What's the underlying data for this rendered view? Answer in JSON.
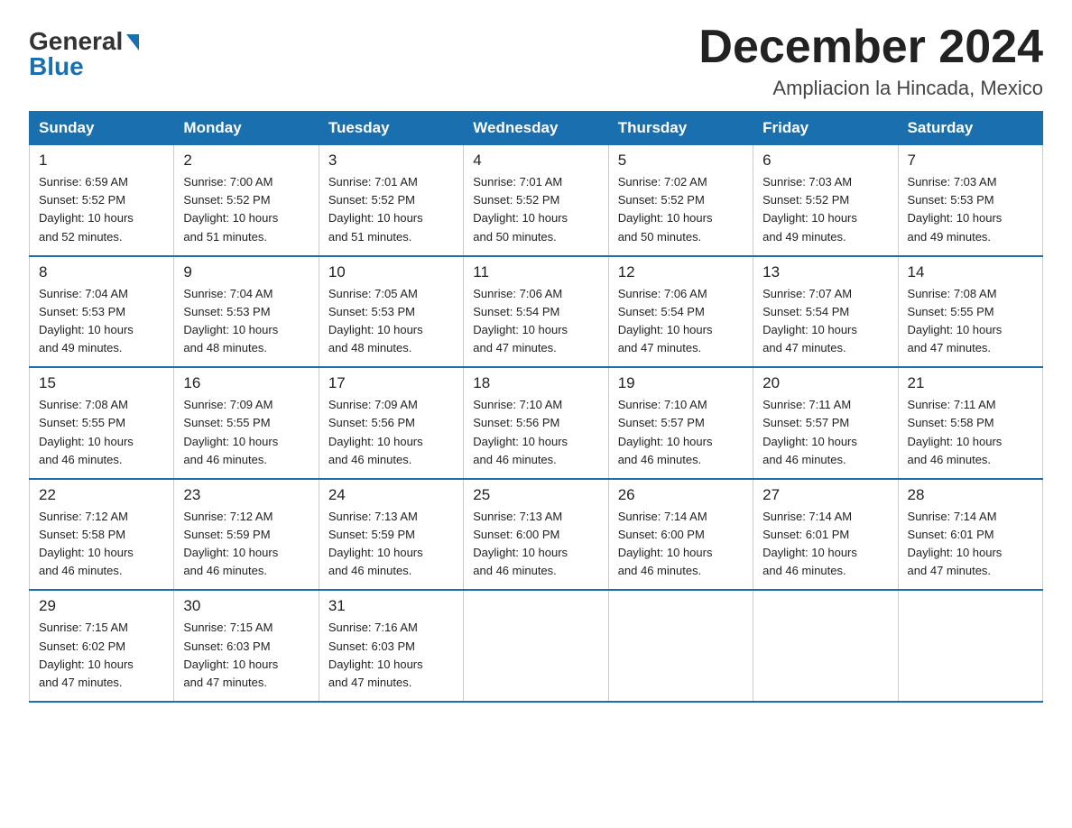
{
  "logo": {
    "text_general": "General",
    "text_blue": "Blue",
    "arrow": true
  },
  "header": {
    "month_title": "December 2024",
    "location": "Ampliacion la Hincada, Mexico"
  },
  "weekdays": [
    "Sunday",
    "Monday",
    "Tuesday",
    "Wednesday",
    "Thursday",
    "Friday",
    "Saturday"
  ],
  "weeks": [
    [
      {
        "day": "1",
        "sunrise": "6:59 AM",
        "sunset": "5:52 PM",
        "daylight": "10 hours and 52 minutes."
      },
      {
        "day": "2",
        "sunrise": "7:00 AM",
        "sunset": "5:52 PM",
        "daylight": "10 hours and 51 minutes."
      },
      {
        "day": "3",
        "sunrise": "7:01 AM",
        "sunset": "5:52 PM",
        "daylight": "10 hours and 51 minutes."
      },
      {
        "day": "4",
        "sunrise": "7:01 AM",
        "sunset": "5:52 PM",
        "daylight": "10 hours and 50 minutes."
      },
      {
        "day": "5",
        "sunrise": "7:02 AM",
        "sunset": "5:52 PM",
        "daylight": "10 hours and 50 minutes."
      },
      {
        "day": "6",
        "sunrise": "7:03 AM",
        "sunset": "5:52 PM",
        "daylight": "10 hours and 49 minutes."
      },
      {
        "day": "7",
        "sunrise": "7:03 AM",
        "sunset": "5:53 PM",
        "daylight": "10 hours and 49 minutes."
      }
    ],
    [
      {
        "day": "8",
        "sunrise": "7:04 AM",
        "sunset": "5:53 PM",
        "daylight": "10 hours and 49 minutes."
      },
      {
        "day": "9",
        "sunrise": "7:04 AM",
        "sunset": "5:53 PM",
        "daylight": "10 hours and 48 minutes."
      },
      {
        "day": "10",
        "sunrise": "7:05 AM",
        "sunset": "5:53 PM",
        "daylight": "10 hours and 48 minutes."
      },
      {
        "day": "11",
        "sunrise": "7:06 AM",
        "sunset": "5:54 PM",
        "daylight": "10 hours and 47 minutes."
      },
      {
        "day": "12",
        "sunrise": "7:06 AM",
        "sunset": "5:54 PM",
        "daylight": "10 hours and 47 minutes."
      },
      {
        "day": "13",
        "sunrise": "7:07 AM",
        "sunset": "5:54 PM",
        "daylight": "10 hours and 47 minutes."
      },
      {
        "day": "14",
        "sunrise": "7:08 AM",
        "sunset": "5:55 PM",
        "daylight": "10 hours and 47 minutes."
      }
    ],
    [
      {
        "day": "15",
        "sunrise": "7:08 AM",
        "sunset": "5:55 PM",
        "daylight": "10 hours and 46 minutes."
      },
      {
        "day": "16",
        "sunrise": "7:09 AM",
        "sunset": "5:55 PM",
        "daylight": "10 hours and 46 minutes."
      },
      {
        "day": "17",
        "sunrise": "7:09 AM",
        "sunset": "5:56 PM",
        "daylight": "10 hours and 46 minutes."
      },
      {
        "day": "18",
        "sunrise": "7:10 AM",
        "sunset": "5:56 PM",
        "daylight": "10 hours and 46 minutes."
      },
      {
        "day": "19",
        "sunrise": "7:10 AM",
        "sunset": "5:57 PM",
        "daylight": "10 hours and 46 minutes."
      },
      {
        "day": "20",
        "sunrise": "7:11 AM",
        "sunset": "5:57 PM",
        "daylight": "10 hours and 46 minutes."
      },
      {
        "day": "21",
        "sunrise": "7:11 AM",
        "sunset": "5:58 PM",
        "daylight": "10 hours and 46 minutes."
      }
    ],
    [
      {
        "day": "22",
        "sunrise": "7:12 AM",
        "sunset": "5:58 PM",
        "daylight": "10 hours and 46 minutes."
      },
      {
        "day": "23",
        "sunrise": "7:12 AM",
        "sunset": "5:59 PM",
        "daylight": "10 hours and 46 minutes."
      },
      {
        "day": "24",
        "sunrise": "7:13 AM",
        "sunset": "5:59 PM",
        "daylight": "10 hours and 46 minutes."
      },
      {
        "day": "25",
        "sunrise": "7:13 AM",
        "sunset": "6:00 PM",
        "daylight": "10 hours and 46 minutes."
      },
      {
        "day": "26",
        "sunrise": "7:14 AM",
        "sunset": "6:00 PM",
        "daylight": "10 hours and 46 minutes."
      },
      {
        "day": "27",
        "sunrise": "7:14 AM",
        "sunset": "6:01 PM",
        "daylight": "10 hours and 46 minutes."
      },
      {
        "day": "28",
        "sunrise": "7:14 AM",
        "sunset": "6:01 PM",
        "daylight": "10 hours and 47 minutes."
      }
    ],
    [
      {
        "day": "29",
        "sunrise": "7:15 AM",
        "sunset": "6:02 PM",
        "daylight": "10 hours and 47 minutes."
      },
      {
        "day": "30",
        "sunrise": "7:15 AM",
        "sunset": "6:03 PM",
        "daylight": "10 hours and 47 minutes."
      },
      {
        "day": "31",
        "sunrise": "7:16 AM",
        "sunset": "6:03 PM",
        "daylight": "10 hours and 47 minutes."
      },
      null,
      null,
      null,
      null
    ]
  ],
  "labels": {
    "sunrise": "Sunrise: ",
    "sunset": "Sunset: ",
    "daylight": "Daylight: "
  }
}
